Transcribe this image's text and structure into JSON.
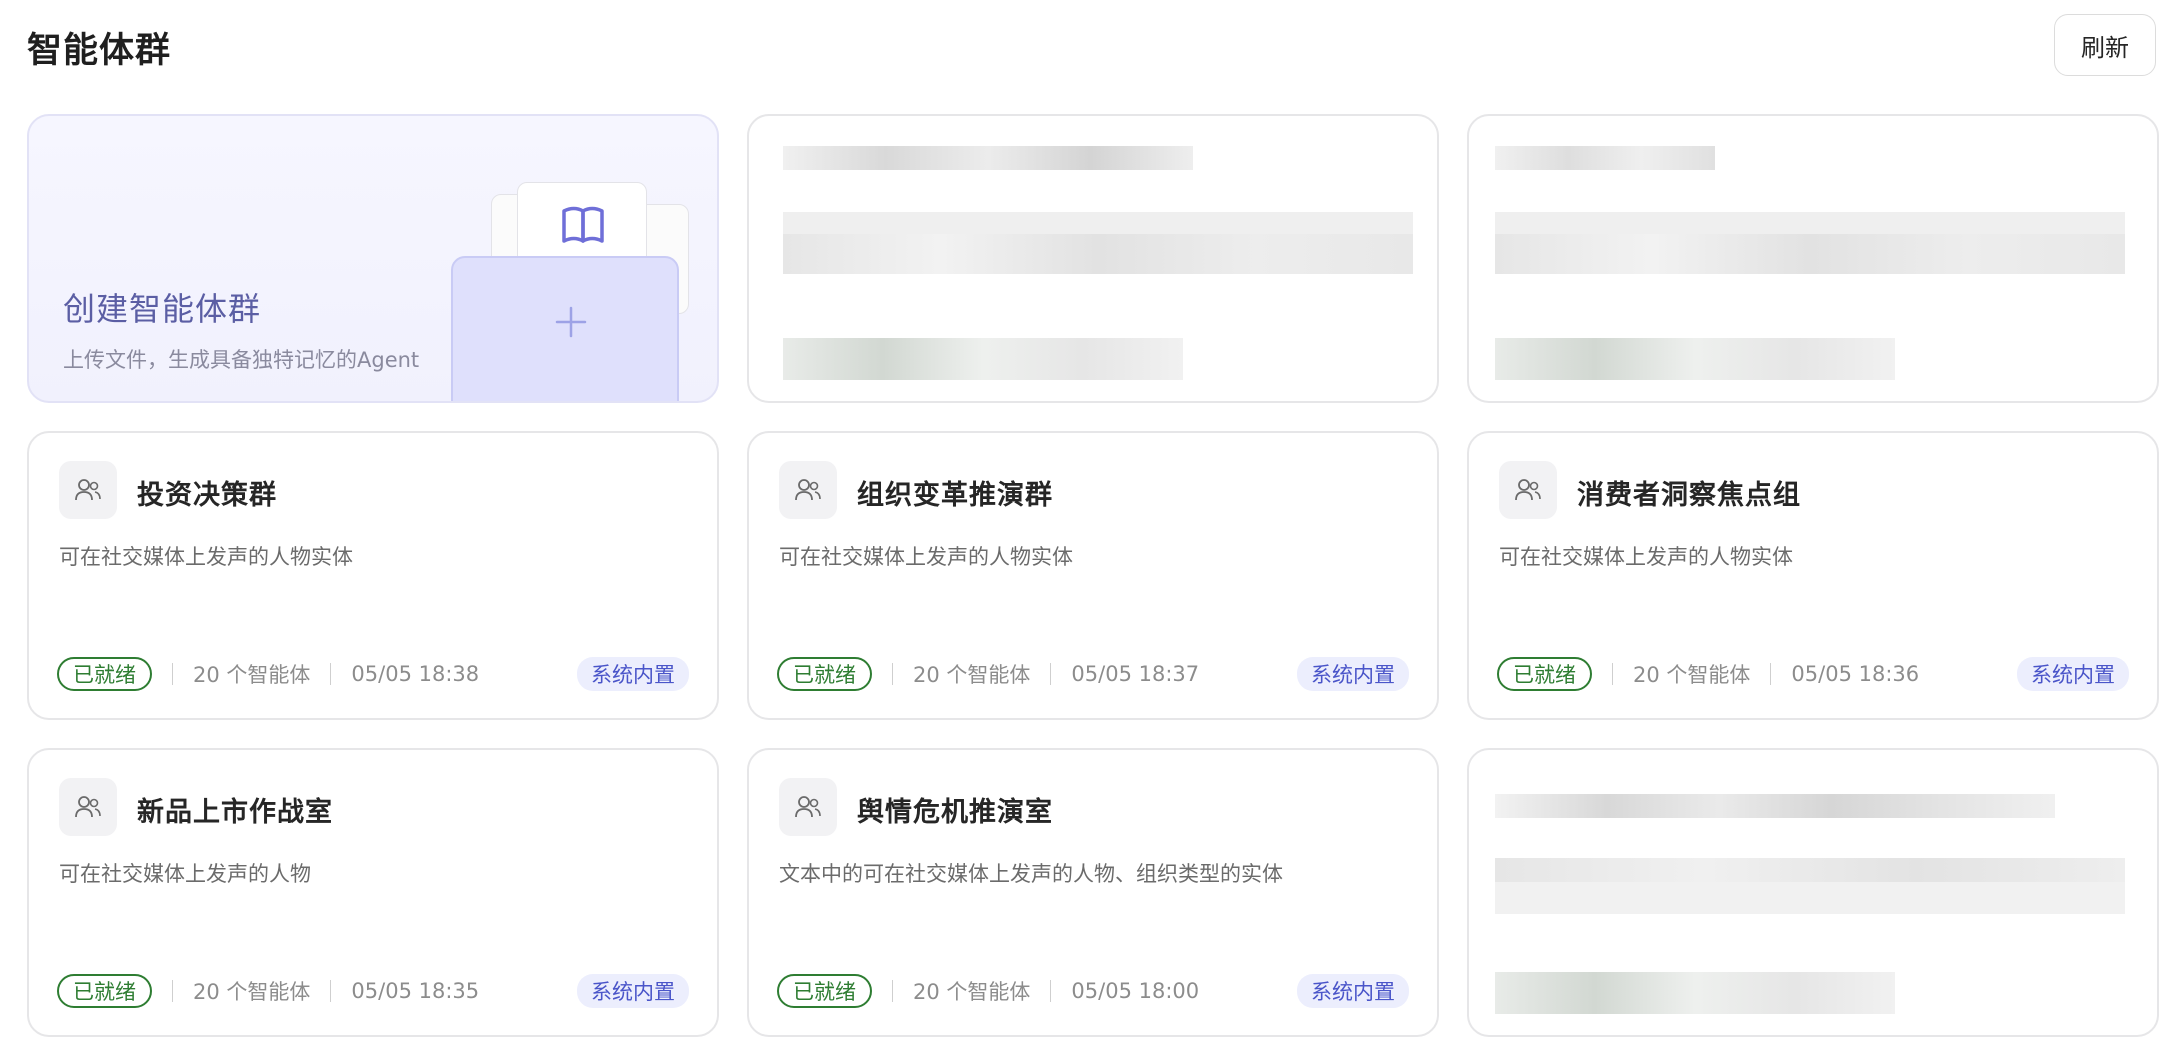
{
  "header": {
    "title": "智能体群",
    "refresh_label": "刷新"
  },
  "create_card": {
    "title": "创建智能体群",
    "subtitle": "上传文件，生成具备独特记忆的Agent",
    "icons": [
      "book-icon",
      "plus-icon"
    ]
  },
  "groups": [
    {
      "name": "投资决策群",
      "desc": "可在社交媒体上发声的人物实体",
      "status": "已就绪",
      "count": "20 个智能体",
      "time": "05/05 18:38",
      "badge": "系统内置",
      "icon": "users-icon"
    },
    {
      "name": "组织变革推演群",
      "desc": "可在社交媒体上发声的人物实体",
      "status": "已就绪",
      "count": "20 个智能体",
      "time": "05/05 18:37",
      "badge": "系统内置",
      "icon": "users-icon"
    },
    {
      "name": "消费者洞察焦点组",
      "desc": "可在社交媒体上发声的人物实体",
      "status": "已就绪",
      "count": "20 个智能体",
      "time": "05/05 18:36",
      "badge": "系统内置",
      "icon": "users-icon"
    },
    {
      "name": "新品上市作战室",
      "desc": "可在社交媒体上发声的人物",
      "status": "已就绪",
      "count": "20 个智能体",
      "time": "05/05 18:35",
      "badge": "系统内置",
      "icon": "users-icon"
    },
    {
      "name": "舆情危机推演室",
      "desc": "文本中的可在社交媒体上发声的人物、组织类型的实体",
      "status": "已就绪",
      "count": "20 个智能体",
      "time": "05/05 18:00",
      "badge": "系统内置",
      "icon": "users-icon"
    }
  ],
  "colors": {
    "ready_green": "#2e7d32",
    "badge_blue": "#4a55c9",
    "create_purple": "#5b5ea4"
  }
}
